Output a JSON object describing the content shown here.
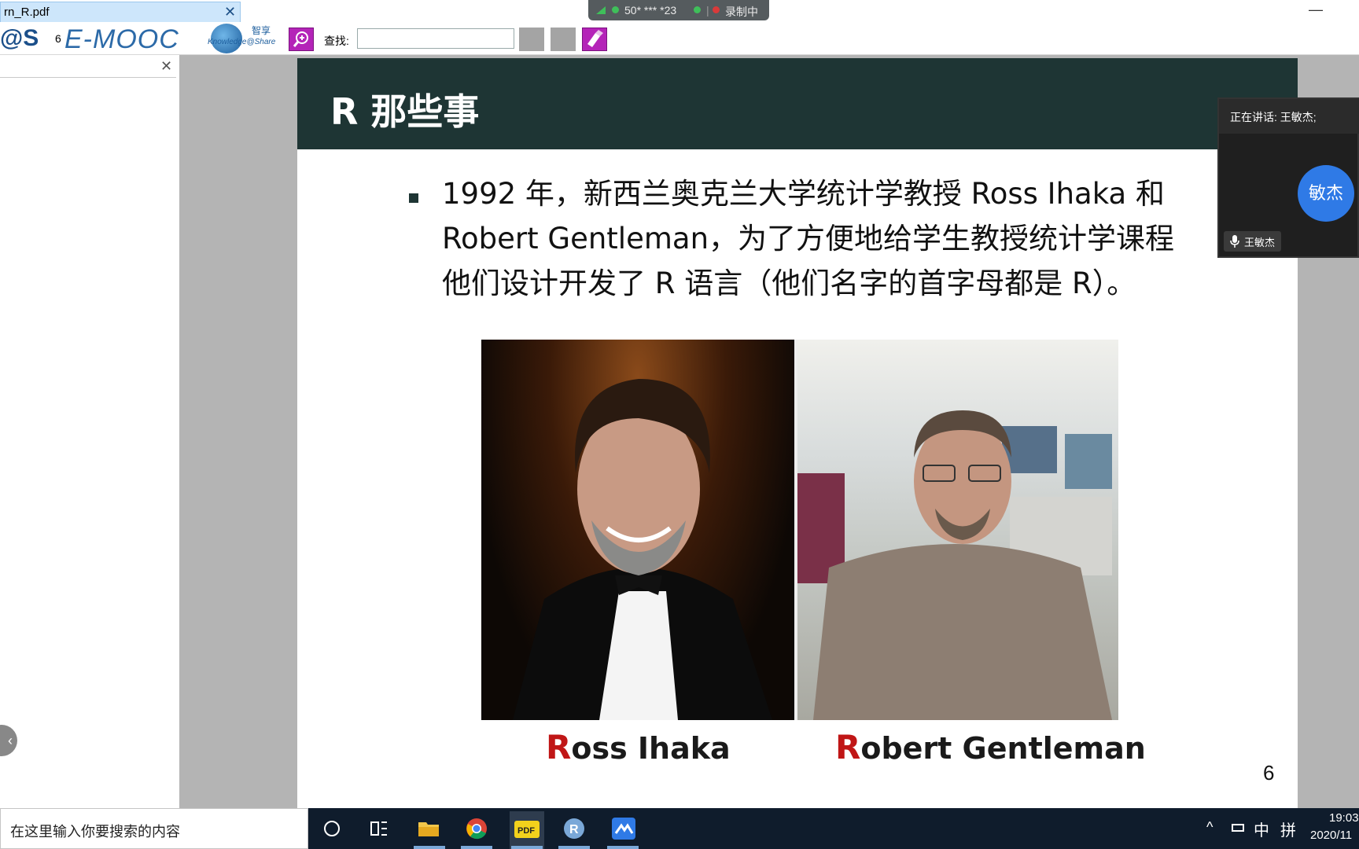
{
  "tab": {
    "title": "rn_R.pdf",
    "close": "✕"
  },
  "meeting": {
    "number": "50* *** *23",
    "separator": "|",
    "recording": "录制中"
  },
  "window": {
    "minimize": "—"
  },
  "toolbar": {
    "logo_as": "@S",
    "page_input": "6",
    "logo_emooc": "E-MOOC",
    "logo_knowledge_zh": "智享",
    "logo_knowledge_en": "Knowledge@Share",
    "find_label": "查找:",
    "find_value": ""
  },
  "left_panel": {
    "close": "✕",
    "collapse": "‹"
  },
  "slide": {
    "title": "R 那些事",
    "lines": [
      "1992 年，新西兰奥克兰大学统计学教授 Ross Ihaka 和",
      "Robert Gentleman，为了方便地给学生教授统计学课程",
      "他们设计开发了 R 语言（他们名字的首字母都是 R）。"
    ],
    "captions": [
      {
        "initial": "R",
        "rest": "oss Ihaka"
      },
      {
        "initial": "R",
        "rest": "obert Gentleman"
      }
    ],
    "page_number": "6"
  },
  "video": {
    "speaking_label": "正在讲话: 王敏杰;",
    "avatar_text": "敏杰",
    "participant_name": "王敏杰"
  },
  "taskbar": {
    "search_placeholder": "在这里输入你要搜索的内容",
    "apps": [
      "cortana-icon",
      "task-view-icon",
      "file-explorer-icon",
      "chrome-icon",
      "pdf-reader-icon",
      "r-icon",
      "meeting-icon"
    ],
    "tray": {
      "up": "^",
      "ime": "中",
      "keyboard": "拼",
      "time": "19:03",
      "date": "2020/11"
    }
  },
  "colors": {
    "slide_header": "#1e3534",
    "caption_initial": "#c01616",
    "toolbar_button": "#b424b8",
    "taskbar": "#0f1c2c",
    "avatar": "#2f7ae6"
  }
}
